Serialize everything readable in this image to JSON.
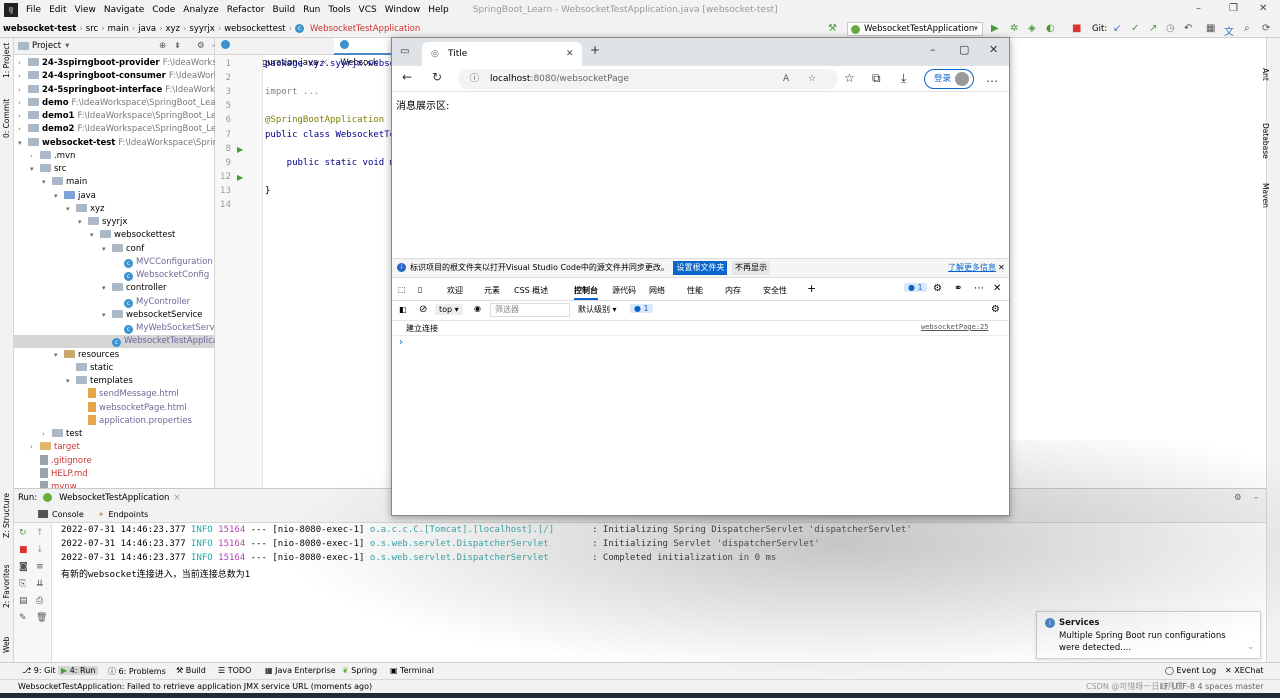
{
  "menu": {
    "items": [
      "File",
      "Edit",
      "View",
      "Navigate",
      "Code",
      "Analyze",
      "Refactor",
      "Build",
      "Run",
      "Tools",
      "VCS",
      "Window",
      "Help"
    ],
    "window_title": "SpringBoot_Learn - WebsocketTestApplication.java [websocket-test]"
  },
  "breadcrumb": [
    "websocket-test",
    "src",
    "main",
    "java",
    "xyz",
    "syyrjx",
    "websockettest",
    "WebsocketTestApplication"
  ],
  "run_config": "WebsocketTestApplication",
  "git_label": "Git:",
  "sidebars": {
    "left": [
      "1: Project",
      "0: Commit",
      "Z: Structure",
      "2: Favorites",
      "Web"
    ],
    "right": [
      "Ant",
      "Database",
      "Maven"
    ]
  },
  "project": {
    "title": "Project",
    "tree": [
      {
        "name": "24-3spirngboot-provider",
        "path": "F:\\IdeaWorkspac",
        "indent": 0,
        "kind": "module",
        "arrow": ">",
        "bold": true
      },
      {
        "name": "24-4springboot-consumer",
        "path": "F:\\IdeaWorkspa",
        "indent": 0,
        "kind": "module",
        "arrow": ">",
        "bold": true
      },
      {
        "name": "24-5springboot-interface",
        "path": "F:\\IdeaWorkspa",
        "indent": 0,
        "kind": "module",
        "arrow": ">",
        "bold": true
      },
      {
        "name": "demo",
        "path": "F:\\IdeaWorkspace\\SpringBoot_Learn",
        "indent": 0,
        "kind": "module",
        "arrow": ">",
        "bold": true
      },
      {
        "name": "demo1",
        "path": "F:\\IdeaWorkspace\\SpringBoot_Learn",
        "indent": 0,
        "kind": "module",
        "arrow": ">",
        "bold": true
      },
      {
        "name": "demo2",
        "path": "F:\\IdeaWorkspace\\SpringBoot_Learn",
        "indent": 0,
        "kind": "module",
        "arrow": ">",
        "bold": true
      },
      {
        "name": "websocket-test",
        "path": "F:\\IdeaWorkspace\\SpringBo",
        "indent": 0,
        "kind": "module",
        "arrow": "v",
        "bold": true
      },
      {
        "name": ".mvn",
        "path": "",
        "indent": 1,
        "kind": "folder",
        "arrow": ">"
      },
      {
        "name": "src",
        "path": "",
        "indent": 1,
        "kind": "folder",
        "arrow": "v"
      },
      {
        "name": "main",
        "path": "",
        "indent": 2,
        "kind": "folder",
        "arrow": "v"
      },
      {
        "name": "java",
        "path": "",
        "indent": 3,
        "kind": "src",
        "arrow": "v"
      },
      {
        "name": "xyz",
        "path": "",
        "indent": 4,
        "kind": "folder",
        "arrow": "v"
      },
      {
        "name": "syyrjx",
        "path": "",
        "indent": 5,
        "kind": "folder",
        "arrow": "v"
      },
      {
        "name": "websockettest",
        "path": "",
        "indent": 6,
        "kind": "folder",
        "arrow": "v"
      },
      {
        "name": "conf",
        "path": "",
        "indent": 7,
        "kind": "folder",
        "arrow": "v"
      },
      {
        "name": "MVCConfiguration",
        "path": "",
        "indent": 8,
        "kind": "class",
        "arrow": "",
        "mod": true
      },
      {
        "name": "WebsocketConfig",
        "path": "",
        "indent": 8,
        "kind": "class",
        "arrow": "",
        "mod": true
      },
      {
        "name": "controller",
        "path": "",
        "indent": 7,
        "kind": "folder",
        "arrow": "v"
      },
      {
        "name": "MyController",
        "path": "",
        "indent": 8,
        "kind": "class",
        "arrow": "",
        "mod": true
      },
      {
        "name": "websocketService",
        "path": "",
        "indent": 7,
        "kind": "folder",
        "arrow": "v"
      },
      {
        "name": "MyWebSocketServi",
        "path": "",
        "indent": 8,
        "kind": "class",
        "arrow": "",
        "mod": true
      },
      {
        "name": "WebsocketTestApplica",
        "path": "",
        "indent": 7,
        "kind": "class",
        "arrow": "",
        "sel": true,
        "mod": true
      },
      {
        "name": "resources",
        "path": "",
        "indent": 3,
        "kind": "res",
        "arrow": "v"
      },
      {
        "name": "static",
        "path": "",
        "indent": 4,
        "kind": "folder",
        "arrow": ""
      },
      {
        "name": "templates",
        "path": "",
        "indent": 4,
        "kind": "folder",
        "arrow": "v"
      },
      {
        "name": "sendMessage.html",
        "path": "",
        "indent": 5,
        "kind": "file",
        "arrow": "",
        "mod": true
      },
      {
        "name": "websocketPage.html",
        "path": "",
        "indent": 5,
        "kind": "file",
        "arrow": "",
        "mod": true
      },
      {
        "name": "application.properties",
        "path": "",
        "indent": 5,
        "kind": "file",
        "arrow": "",
        "mod": true
      },
      {
        "name": "test",
        "path": "",
        "indent": 2,
        "kind": "folder",
        "arrow": ">"
      },
      {
        "name": "target",
        "path": "",
        "indent": 1,
        "kind": "target",
        "arrow": ">",
        "red": true
      },
      {
        "name": ".gitignore",
        "path": "",
        "indent": 1,
        "kind": "grey",
        "arrow": "",
        "red": true
      },
      {
        "name": "HELP.md",
        "path": "",
        "indent": 1,
        "kind": "grey",
        "arrow": "",
        "red": true
      },
      {
        "name": "mvnw",
        "path": "",
        "indent": 1,
        "kind": "grey",
        "arrow": "",
        "red": true
      }
    ]
  },
  "editor": {
    "tabs": [
      "MVCConfiguration.java",
      "Websock"
    ],
    "lines": [
      {
        "n": "1",
        "text": "package xyz.syyrjx.websoc"
      },
      {
        "n": "2",
        "text": ""
      },
      {
        "n": "3",
        "text": "import ..."
      },
      {
        "n": "5",
        "text": ""
      },
      {
        "n": "6",
        "text": "@SpringBootApplication"
      },
      {
        "n": "7",
        "text": "public class WebsocketTe"
      },
      {
        "n": "8",
        "text": ""
      },
      {
        "n": "9",
        "text": "    public static void m"
      },
      {
        "n": "12",
        "text": ""
      },
      {
        "n": "13",
        "text": "}"
      },
      {
        "n": "14",
        "text": ""
      }
    ]
  },
  "browser": {
    "tab_title": "Title",
    "url_host": "localhost",
    "url_rest": ":8080/websocketPage",
    "login_label": "登录",
    "page_heading": "消息展示区:",
    "notification": {
      "text": "标识项目的根文件夹以打开Visual Studio Code中的源文件并同步更改。",
      "primary_btn": "设置根文件夹",
      "secondary_btn": "不再显示",
      "link": "了解更多信息"
    },
    "devtools_tabs": [
      "欢迎",
      "元素",
      "CSS 概述",
      "控制台",
      "源代码",
      "网络",
      "性能",
      "内存",
      "安全性"
    ],
    "active_devtools_tab": "控制台",
    "issue_count": "1",
    "top_context": "top",
    "filter_placeholder": "筛选器",
    "log_level": "默认级别",
    "console_badge": "1",
    "console_message": "建立连接",
    "console_source": "websocketPage:25",
    "prompt": "›"
  },
  "run": {
    "label": "Run:",
    "config": "WebsocketTestApplication",
    "tabs": [
      "Console",
      "Endpoints"
    ],
    "logs": [
      {
        "ts": "2022-07-31 14:46:23.377",
        "level": "INFO",
        "pid": "15164",
        "sep": "---",
        "thread": "[nio-8080-exec-1]",
        "cat": "o.a.c.c.C.[Tomcat].[localhost].[/]      ",
        "msg": ": Initializing Spring DispatcherServlet 'dispatcherServlet'"
      },
      {
        "ts": "2022-07-31 14:46:23.377",
        "level": "INFO",
        "pid": "15164",
        "sep": "---",
        "thread": "[nio-8080-exec-1]",
        "cat": "o.s.web.servlet.DispatcherServlet       ",
        "msg": ": Initializing Servlet 'dispatcherServlet'"
      },
      {
        "ts": "2022-07-31 14:46:23.377",
        "level": "INFO",
        "pid": "15164",
        "sep": "---",
        "thread": "[nio-8080-exec-1]",
        "cat": "o.s.web.servlet.DispatcherServlet       ",
        "msg": ": Completed initialization in 0 ms"
      }
    ],
    "plain_line": "有新的websocket连接进入，当前连接总数为1"
  },
  "services_popup": {
    "title": "Services",
    "body_line1": "Multiple Spring Boot run configurations",
    "body_line2": "were detected...."
  },
  "bottom_tools": [
    "9: Git",
    "4: Run",
    "6: Problems",
    "Build",
    "TODO",
    "Java Enterprise",
    "Spring",
    "Terminal"
  ],
  "bottom_right_tools": [
    "Event Log",
    "XEChat"
  ],
  "status": {
    "message": "WebsocketTestApplication: Failed to retrieve application JMX service URL (moments ago)",
    "right": "LF  UTF-8  4 spaces  master",
    "watermark": "CSDN @可惜呀一日的月日"
  }
}
